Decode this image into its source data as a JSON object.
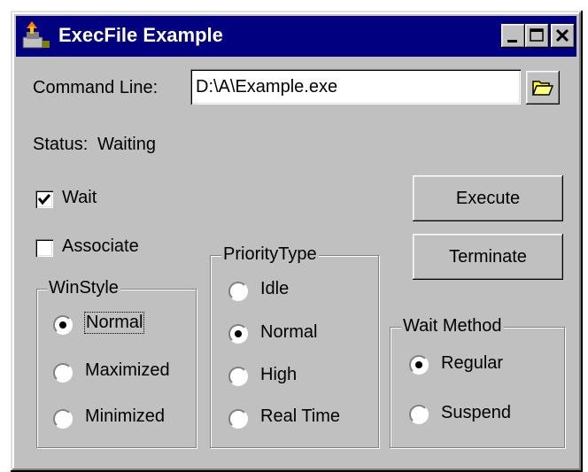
{
  "window": {
    "title": "ExecFile Example",
    "colors": {
      "face": "#c0c0c0",
      "titlebar": "#000080",
      "title_text": "#ffffff"
    }
  },
  "title_buttons": [
    "minimize",
    "maximize",
    "close"
  ],
  "command_line": {
    "label": "Command Line:",
    "value": "D:\\A\\Example.exe",
    "browse_icon": "folder-open-icon"
  },
  "status": {
    "label": "Status:",
    "value": "Waiting"
  },
  "options": {
    "wait": {
      "label": "Wait",
      "checked": true
    },
    "associate": {
      "label": "Associate",
      "checked": false
    }
  },
  "buttons": {
    "execute": "Execute",
    "terminate": "Terminate"
  },
  "winstyle": {
    "title": "WinStyle",
    "items": [
      {
        "label": "Normal",
        "selected": true
      },
      {
        "label": "Maximized",
        "selected": false
      },
      {
        "label": "Minimized",
        "selected": false
      }
    ]
  },
  "priority": {
    "title": "PriorityType",
    "items": [
      {
        "label": "Idle",
        "selected": false
      },
      {
        "label": "Normal",
        "selected": true
      },
      {
        "label": "High",
        "selected": false
      },
      {
        "label": "Real Time",
        "selected": false
      }
    ]
  },
  "wait_method": {
    "title": "Wait Method",
    "items": [
      {
        "label": "Regular",
        "selected": true
      },
      {
        "label": "Suspend",
        "selected": false
      }
    ]
  }
}
